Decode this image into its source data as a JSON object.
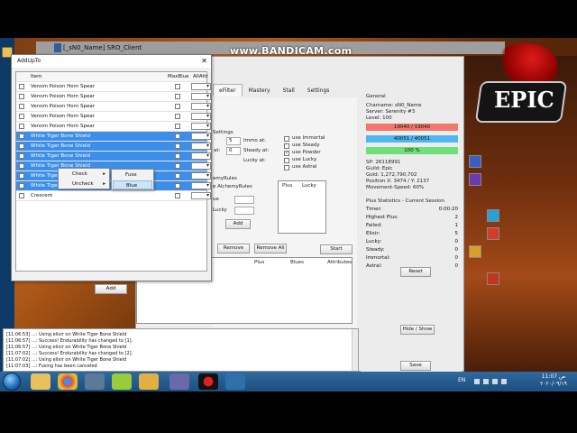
{
  "recorder": {
    "watermark": "www.BANDICAM.com"
  },
  "game_window": {
    "title": "[_sN0_Name]  SRO_Client"
  },
  "tool": {
    "tabs": [
      "eFilter",
      "Mastery",
      "Stall",
      "Settings"
    ],
    "settings_label": "Settings",
    "immo_at_label": "Immo at:",
    "immo_value": "5",
    "at_label": "at:",
    "at_value": "0",
    "steady_at_label": "Steady at:",
    "lucky_at_label": "Lucky at:",
    "options": [
      {
        "label": "use Immortal",
        "checked": false
      },
      {
        "label": "use Steady",
        "checked": false
      },
      {
        "label": "use Powder",
        "checked": true
      },
      {
        "label": "use Lucky",
        "checked": false
      },
      {
        "label": "use Astral",
        "checked": false
      }
    ],
    "alchemy_rules_title": "emyRules",
    "alchemy_rules_label": "e AlchemyRules",
    "rules_ue_label": "ue",
    "rules_lucky_label": "Lucky",
    "rules_columns": [
      "Plus",
      "Lucky"
    ],
    "add_button": "Add",
    "remove_button": "Remove",
    "remove_all_button": "Remove All",
    "start_button": "Start",
    "lower_list_columns": [
      "Plus",
      "Blues",
      "Attributes"
    ]
  },
  "general": {
    "heading": "General",
    "charname": "Charname: sN0_Name",
    "server": "Server: Serenity #3",
    "level": "Level: 100",
    "hp": {
      "text": "19040 / 19040",
      "color": "#f0776a"
    },
    "mp": {
      "text": "40051 / 40051",
      "color": "#4fb6f0"
    },
    "exp": {
      "text": "100 %",
      "color": "#6de07a"
    },
    "sp": "SP: 26118991",
    "guild": "Guild: Epic",
    "gold": "Gold: 1,272,790,702",
    "position": "Position X: 3474 / Y: 2137",
    "movement_speed": "Movement-Speed: 60%",
    "plus_stats_heading": "Plus Statistics - Current Session",
    "stats": [
      {
        "label": "Timer:",
        "value": "0:00:20"
      },
      {
        "label": "Highest Plus:",
        "value": "2"
      },
      {
        "label": "Failed:",
        "value": "1"
      },
      {
        "label": "Elixir:",
        "value": "5"
      },
      {
        "label": "Lucky:",
        "value": "0"
      },
      {
        "label": "Steady:",
        "value": "0"
      },
      {
        "label": "Immortal:",
        "value": "0"
      },
      {
        "label": "Astral:",
        "value": "0"
      }
    ],
    "reset_button": "Reset",
    "hide_show_button": "Hide / Show",
    "save_button": "Save"
  },
  "addup": {
    "title": "AddUpTo",
    "columns": {
      "item": "Item",
      "maxblue": "MaxBlue",
      "allattr": "AllAttr"
    },
    "rows": [
      {
        "name": "Venom Poison Horn Spear",
        "selected": false
      },
      {
        "name": "Venom Poison Horn Spear",
        "selected": false
      },
      {
        "name": "Venom Poison Horn Spear",
        "selected": false
      },
      {
        "name": "Venom Poison Horn Spear",
        "selected": false
      },
      {
        "name": "Venom Poison Horn Spear",
        "selected": false
      },
      {
        "name": "White Tiger Bone Shield",
        "selected": true
      },
      {
        "name": "White Tiger Bone Shield",
        "selected": true
      },
      {
        "name": "White Tiger Bone Shield",
        "selected": true
      },
      {
        "name": "White Tiger Bone Shield",
        "selected": true
      },
      {
        "name": "White Tiger B",
        "selected": true
      },
      {
        "name": "White Tiger B",
        "selected": true
      },
      {
        "name": "Crescent",
        "selected": false
      }
    ],
    "add_button": "Add"
  },
  "context_menu": {
    "items": [
      "Check",
      "Uncheck"
    ],
    "submenu": [
      "Fuse",
      "Blue"
    ]
  },
  "log": [
    "[11:06:53] ...: Using elixir on White Tiger Bone Shield",
    "[11:06:57] ...: Success! Endurability has changed to [1].",
    "[11:06:57] ...: Using elixir on White Tiger Bone Shield",
    "[11:07:02] ...: Success! Endurability has changed to [2].",
    "[11:07:02] ...: Using elixir on White Tiger Bone Shield",
    "[11:07:03] ...: Fusing has been canceled"
  ],
  "taskbar": {
    "lang": "EN",
    "time": "11:07 ص",
    "date": "٢٠٢٠/٠٩/١٩"
  }
}
